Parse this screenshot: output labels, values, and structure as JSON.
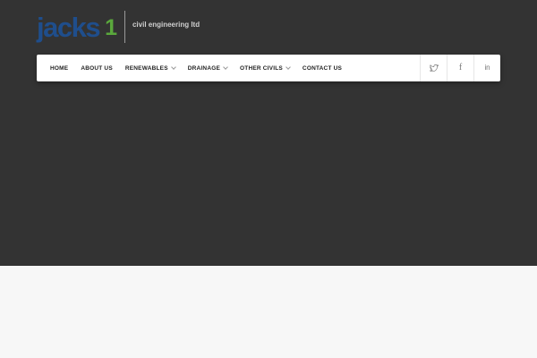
{
  "logo": {
    "wordmark": "jacks",
    "number": "1",
    "tagline": "civil engineering ltd"
  },
  "nav": {
    "items": [
      {
        "label": "Home",
        "has_dropdown": false
      },
      {
        "label": "About Us",
        "has_dropdown": false
      },
      {
        "label": "Renewables",
        "has_dropdown": true
      },
      {
        "label": "Drainage",
        "has_dropdown": true
      },
      {
        "label": "Other Civils",
        "has_dropdown": true
      },
      {
        "label": "Contact Us",
        "has_dropdown": false
      }
    ],
    "social": {
      "twitter_icon": "twitter-icon",
      "facebook_glyph": "f",
      "linkedin_glyph": "in"
    }
  },
  "colors": {
    "hero_background": "#333333",
    "below_background": "#f7f7f7",
    "logo_blue": "#1f4e8c",
    "logo_green": "#5aa83c"
  }
}
